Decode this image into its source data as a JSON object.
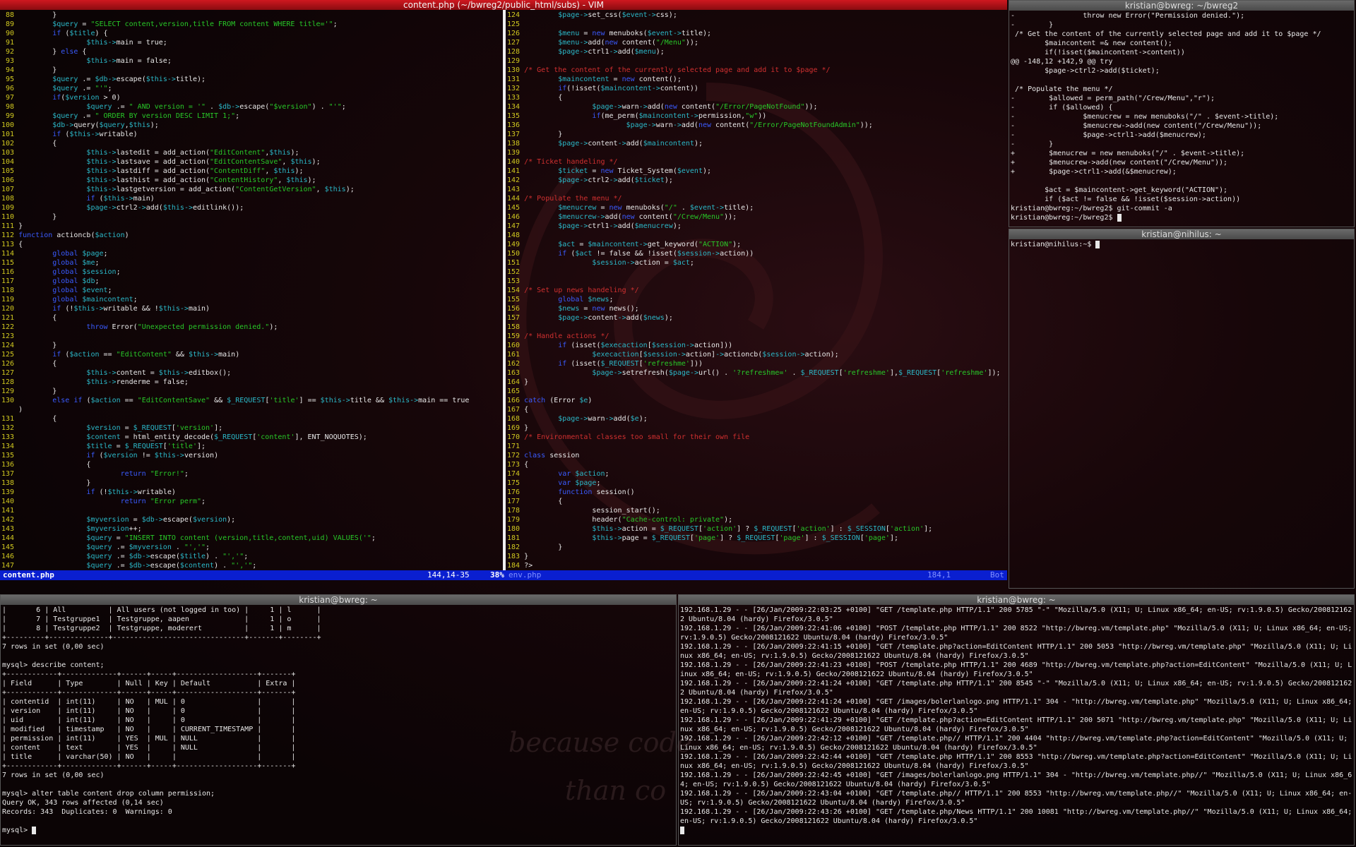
{
  "vim": {
    "title": "content.php (~/bwreg2/public_html/subs) - VIM",
    "status_left_file": "content.php",
    "status_left_pos": "144,14-35",
    "status_left_pct": "38%",
    "status_right_file": "env.php",
    "status_right_pos": "184,1",
    "status_right_pct": "Bot"
  },
  "left_code": [
    {
      "n": "88",
      "t": "        }"
    },
    {
      "n": "89",
      "t": "        $query = \"SELECT content,version,title FROM content WHERE title='\";"
    },
    {
      "n": "90",
      "t": "        if ($title) {"
    },
    {
      "n": "91",
      "t": "                $this->main = true;"
    },
    {
      "n": "92",
      "t": "        } else {"
    },
    {
      "n": "93",
      "t": "                $this->main = false;"
    },
    {
      "n": "94",
      "t": "        }"
    },
    {
      "n": "95",
      "t": "        $query .= $db->escape($this->title);"
    },
    {
      "n": "96",
      "t": "        $query .= \"'\";"
    },
    {
      "n": "97",
      "t": "        if($version > 0)"
    },
    {
      "n": "98",
      "t": "                $query .= \" AND version = '\" . $db->escape(\"$version\") . \"'\";"
    },
    {
      "n": "99",
      "t": "        $query .= \" ORDER BY version DESC LIMIT 1;\";"
    },
    {
      "n": "100",
      "t": "        $db->query($query,$this);"
    },
    {
      "n": "101",
      "t": "        if ($this->writable)"
    },
    {
      "n": "102",
      "t": "        {"
    },
    {
      "n": "103",
      "t": "                $this->lastedit = add_action(\"EditContent\",$this);"
    },
    {
      "n": "104",
      "t": "                $this->lastsave = add_action(\"EditContentSave\", $this);"
    },
    {
      "n": "105",
      "t": "                $this->lastdiff = add_action(\"ContentDiff\", $this);"
    },
    {
      "n": "106",
      "t": "                $this->lasthist = add_action(\"ContentHistory\", $this);"
    },
    {
      "n": "107",
      "t": "                $this->lastgetversion = add_action(\"ContentGetVersion\", $this);"
    },
    {
      "n": "108",
      "t": "                if ($this->main)"
    },
    {
      "n": "109",
      "t": "                $page->ctrl2->add($this->editlink());"
    },
    {
      "n": "110",
      "t": "        }"
    },
    {
      "n": "111",
      "t": "}"
    },
    {
      "n": "112",
      "t": "function actioncb($action)"
    },
    {
      "n": "113",
      "t": "{"
    },
    {
      "n": "114",
      "t": "        global $page;"
    },
    {
      "n": "115",
      "t": "        global $me;"
    },
    {
      "n": "116",
      "t": "        global $session;"
    },
    {
      "n": "117",
      "t": "        global $db;"
    },
    {
      "n": "118",
      "t": "        global $event;"
    },
    {
      "n": "119",
      "t": "        global $maincontent;"
    },
    {
      "n": "120",
      "t": "        if (!$this->writable && !$this->main)"
    },
    {
      "n": "121",
      "t": "        {"
    },
    {
      "n": "122",
      "t": "                throw Error(\"Unexpected permission denied.\");"
    },
    {
      "n": "123",
      "t": ""
    },
    {
      "n": "124",
      "t": "        }"
    },
    {
      "n": "125",
      "t": "        if ($action == \"EditContent\" && $this->main)"
    },
    {
      "n": "126",
      "t": "        {"
    },
    {
      "n": "127",
      "t": "                $this->content = $this->editbox();"
    },
    {
      "n": "128",
      "t": "                $this->renderme = false;"
    },
    {
      "n": "129",
      "t": "        }"
    },
    {
      "n": "130",
      "t": "        else if ($action == \"EditContentSave\" && $_REQUEST['title'] == $this->title && $this->main == true"
    },
    {
      "n": "",
      "t": ")"
    },
    {
      "n": "131",
      "t": "        {"
    },
    {
      "n": "132",
      "t": "                $version = $_REQUEST['version'];"
    },
    {
      "n": "133",
      "t": "                $content = html_entity_decode($_REQUEST['content'], ENT_NOQUOTES);"
    },
    {
      "n": "134",
      "t": "                $title = $_REQUEST['title'];"
    },
    {
      "n": "135",
      "t": "                if ($version != $this->version)"
    },
    {
      "n": "136",
      "t": "                {"
    },
    {
      "n": "137",
      "t": "                        return \"Error!\";"
    },
    {
      "n": "138",
      "t": "                }"
    },
    {
      "n": "139",
      "t": "                if (!$this->writable)"
    },
    {
      "n": "140",
      "t": "                        return \"Error perm\";"
    },
    {
      "n": "141",
      "t": ""
    },
    {
      "n": "142",
      "t": "                $myversion = $db->escape($version);"
    },
    {
      "n": "143",
      "t": "                $myversion++;"
    },
    {
      "n": "144",
      "t": "                $query = \"INSERT INTO content (version,title,content,uid) VALUES('\";"
    },
    {
      "n": "145",
      "t": "                $query .= $myversion . \"','\";"
    },
    {
      "n": "146",
      "t": "                $query .= $db->escape($title) . \"','\";"
    },
    {
      "n": "147",
      "t": "                $query .= $db->escape($content) . \"','\";"
    }
  ],
  "right_code": [
    {
      "n": "124",
      "t": "        $page->set_css($event->css);"
    },
    {
      "n": "125",
      "t": ""
    },
    {
      "n": "126",
      "t": "        $menu = new menuboks($event->title);"
    },
    {
      "n": "127",
      "t": "        $menu->add(new content(\"/Menu\"));"
    },
    {
      "n": "128",
      "t": "        $page->ctrl1->add($menu);"
    },
    {
      "n": "129",
      "t": ""
    },
    {
      "n": "130",
      "t": "/* Get the content of the currently selected page and add it to $page */"
    },
    {
      "n": "131",
      "t": "        $maincontent = new content();"
    },
    {
      "n": "132",
      "t": "        if(!isset($maincontent->content))"
    },
    {
      "n": "133",
      "t": "        {"
    },
    {
      "n": "134",
      "t": "                $page->warn->add(new content(\"/Error/PageNotFound\"));"
    },
    {
      "n": "135",
      "t": "                if(me_perm($maincontent->permission,\"w\"))"
    },
    {
      "n": "136",
      "t": "                        $page->warn->add(new content(\"/Error/PageNotFoundAdmin\"));"
    },
    {
      "n": "137",
      "t": "        }"
    },
    {
      "n": "138",
      "t": "        $page->content->add($maincontent);"
    },
    {
      "n": "139",
      "t": ""
    },
    {
      "n": "140",
      "t": "/* Ticket handeling */"
    },
    {
      "n": "141",
      "t": "        $ticket = new Ticket_System($event);"
    },
    {
      "n": "142",
      "t": "        $page->ctrl2->add($ticket);"
    },
    {
      "n": "143",
      "t": ""
    },
    {
      "n": "144",
      "t": "/* Populate the menu */"
    },
    {
      "n": "145",
      "t": "        $menucrew = new menuboks(\"/\" . $event->title);"
    },
    {
      "n": "146",
      "t": "        $menucrew->add(new content(\"/Crew/Menu\"));"
    },
    {
      "n": "147",
      "t": "        $page->ctrl1->add($menucrew);"
    },
    {
      "n": "148",
      "t": ""
    },
    {
      "n": "149",
      "t": "        $act = $maincontent->get_keyword(\"ACTION\");"
    },
    {
      "n": "150",
      "t": "        if ($act != false && !isset($session->action))"
    },
    {
      "n": "151",
      "t": "                $session->action = $act;"
    },
    {
      "n": "152",
      "t": ""
    },
    {
      "n": "153",
      "t": ""
    },
    {
      "n": "154",
      "t": "/* Set up news handeling */"
    },
    {
      "n": "155",
      "t": "        global $news;"
    },
    {
      "n": "156",
      "t": "        $news = new news();"
    },
    {
      "n": "157",
      "t": "        $page->content->add($news);"
    },
    {
      "n": "158",
      "t": ""
    },
    {
      "n": "159",
      "t": "/* Handle actions */"
    },
    {
      "n": "160",
      "t": "        if (isset($execaction[$session->action]))"
    },
    {
      "n": "161",
      "t": "                $execaction[$session->action]->actioncb($session->action);"
    },
    {
      "n": "162",
      "t": "        if (isset($_REQUEST['refreshme']))"
    },
    {
      "n": "163",
      "t": "                $page->setrefresh($page->url() . '?refreshme=' . $_REQUEST['refreshme'],$_REQUEST['refreshme']);"
    },
    {
      "n": "164",
      "t": "}"
    },
    {
      "n": "165",
      "t": ""
    },
    {
      "n": "166",
      "t": "catch (Error $e)"
    },
    {
      "n": "167",
      "t": "{"
    },
    {
      "n": "168",
      "t": "        $page->warn->add($e);"
    },
    {
      "n": "169",
      "t": "}"
    },
    {
      "n": "170",
      "t": "/* Environmental classes too small for their own file"
    },
    {
      "n": "171",
      "t": ""
    },
    {
      "n": "172",
      "t": "class session"
    },
    {
      "n": "173",
      "t": "{"
    },
    {
      "n": "174",
      "t": "        var $action;"
    },
    {
      "n": "175",
      "t": "        var $page;"
    },
    {
      "n": "176",
      "t": "        function session()"
    },
    {
      "n": "177",
      "t": "        {"
    },
    {
      "n": "178",
      "t": "                session_start();"
    },
    {
      "n": "179",
      "t": "                header(\"Cache-control: private\");"
    },
    {
      "n": "180",
      "t": "                $this->action = $_REQUEST['action'] ? $_REQUEST['action'] : $_SESSION['action'];"
    },
    {
      "n": "181",
      "t": "                $this->page = $_REQUEST['page'] ? $_REQUEST['page'] : $_SESSION['page'];"
    },
    {
      "n": "182",
      "t": "        }"
    },
    {
      "n": "183",
      "t": "}"
    },
    {
      "n": "184",
      "t": "?>"
    }
  ],
  "diff_term": {
    "title": "kristian@bwreg: ~/bwreg2",
    "text": "-                throw new Error(\"Permission denied.\");\n-        }\n /* Get the content of the currently selected page and add it to $page */\n        $maincontent =& new content();\n        if(!isset($maincontent->content))\n@@ -148,12 +142,9 @@ try\n        $page->ctrl2->add($ticket);\n\n /* Populate the menu */\n-        $allowed = perm_path(\"/Crew/Menu\",\"r\");\n-        if ($allowed) {\n-                $menucrew = new menuboks(\"/\" . $event->title);\n-                $menucrew->add(new content(\"/Crew/Menu\"));\n-                $page->ctrl1->add($menucrew);\n-        }\n+        $menucrew = new menuboks(\"/\" . $event->title);\n+        $menucrew->add(new content(\"/Crew/Menu\"));\n+        $page->ctrl1->add(&$menucrew);\n\n        $act = $maincontent->get_keyword(\"ACTION\");\n        if ($act != false && !isset($session->action))\nkristian@bwreg:~/bwreg2$ git-commit -a\nkristian@bwreg:~/bwreg2$ "
  },
  "nihilus_term": {
    "title": "kristian@nihilus: ~",
    "text": "kristian@nihilus:~$ "
  },
  "mysql_term": {
    "title": "kristian@bwreg: ~",
    "text": "|       6 | All          | All users (not logged in too) |     1 | l      |\n|       7 | Testgruppe1  | Testgruppe, aapen             |     1 | o      |\n|       8 | Testgruppe2  | Testgruppe, moderert          |     1 | m      |\n+---------+--------------+-------------------------------+-------+--------+\n7 rows in set (0,00 sec)\n\nmysql> describe content;\n+------------+-------------+------+-----+-------------------+-------+\n| Field      | Type        | Null | Key | Default           | Extra |\n+------------+-------------+------+-----+-------------------+-------+\n| contentid  | int(11)     | NO   | MUL | 0                 |       |\n| version    | int(11)     | NO   |     | 0                 |       |\n| uid        | int(11)     | NO   |     | 0                 |       |\n| modified   | timestamp   | NO   |     | CURRENT_TIMESTAMP |       |\n| permission | int(11)     | YES  | MUL | NULL              |       |\n| content    | text        | YES  |     | NULL              |       |\n| title      | varchar(50) | NO   |     |                   |       |\n+------------+-------------+------+-----+-------------------+-------+\n7 rows in set (0,00 sec)\n\nmysql> alter table content drop column permission;\nQuery OK, 343 rows affected (0,14 sec)\nRecords: 343  Duplicates: 0  Warnings: 0\n\nmysql> "
  },
  "log_term": {
    "title": "kristian@bwreg: ~",
    "text": "192.168.1.29 - - [26/Jan/2009:22:03:25 +0100] \"GET /template.php HTTP/1.1\" 200 5785 \"-\" \"Mozilla/5.0 (X11; U; Linux x86_64; en-US; rv:1.9.0.5) Gecko/2008121622 Ubuntu/8.04 (hardy) Firefox/3.0.5\"\n192.168.1.29 - - [26/Jan/2009:22:41:06 +0100] \"POST /template.php HTTP/1.1\" 200 8522 \"http://bwreg.vm/template.php\" \"Mozilla/5.0 (X11; U; Linux x86_64; en-US; rv:1.9.0.5) Gecko/2008121622 Ubuntu/8.04 (hardy) Firefox/3.0.5\"\n192.168.1.29 - - [26/Jan/2009:22:41:15 +0100] \"GET /template.php?action=EditContent HTTP/1.1\" 200 5053 \"http://bwreg.vm/template.php\" \"Mozilla/5.0 (X11; U; Linux x86_64; en-US; rv:1.9.0.5) Gecko/2008121622 Ubuntu/8.04 (hardy) Firefox/3.0.5\"\n192.168.1.29 - - [26/Jan/2009:22:41:23 +0100] \"POST /template.php HTTP/1.1\" 200 4689 \"http://bwreg.vm/template.php?action=EditContent\" \"Mozilla/5.0 (X11; U; Linux x86_64; en-US; rv:1.9.0.5) Gecko/2008121622 Ubuntu/8.04 (hardy) Firefox/3.0.5\"\n192.168.1.29 - - [26/Jan/2009:22:41:24 +0100] \"GET /template.php HTTP/1.1\" 200 8545 \"-\" \"Mozilla/5.0 (X11; U; Linux x86_64; en-US; rv:1.9.0.5) Gecko/2008121622 Ubuntu/8.04 (hardy) Firefox/3.0.5\"\n192.168.1.29 - - [26/Jan/2009:22:41:24 +0100] \"GET /images/bolerlanlogo.png HTTP/1.1\" 304 - \"http://bwreg.vm/template.php\" \"Mozilla/5.0 (X11; U; Linux x86_64; en-US; rv:1.9.0.5) Gecko/2008121622 Ubuntu/8.04 (hardy) Firefox/3.0.5\"\n192.168.1.29 - - [26/Jan/2009:22:41:29 +0100] \"GET /template.php?action=EditContent HTTP/1.1\" 200 5071 \"http://bwreg.vm/template.php\" \"Mozilla/5.0 (X11; U; Linux x86_64; en-US; rv:1.9.0.5) Gecko/2008121622 Ubuntu/8.04 (hardy) Firefox/3.0.5\"\n192.168.1.29 - - [26/Jan/2009:22:42:12 +0100] \"GET /template.php// HTTP/1.1\" 200 4404 \"http://bwreg.vm/template.php?action=EditContent\" \"Mozilla/5.0 (X11; U; Linux x86_64; en-US; rv:1.9.0.5) Gecko/2008121622 Ubuntu/8.04 (hardy) Firefox/3.0.5\"\n192.168.1.29 - - [26/Jan/2009:22:42:44 +0100] \"GET /template.php HTTP/1.1\" 200 8553 \"http://bwreg.vm/template.php?action=EditContent\" \"Mozilla/5.0 (X11; U; Linux x86_64; en-US; rv:1.9.0.5) Gecko/2008121622 Ubuntu/8.04 (hardy) Firefox/3.0.5\"\n192.168.1.29 - - [26/Jan/2009:22:42:45 +0100] \"GET /images/bolerlanlogo.png HTTP/1.1\" 304 - \"http://bwreg.vm/template.php//\" \"Mozilla/5.0 (X11; U; Linux x86_64; en-US; rv:1.9.0.5) Gecko/2008121622 Ubuntu/8.04 (hardy) Firefox/3.0.5\"\n192.168.1.29 - - [26/Jan/2009:22:43:04 +0100] \"GET /template.php// HTTP/1.1\" 200 8553 \"http://bwreg.vm/template.php//\" \"Mozilla/5.0 (X11; U; Linux x86_64; en-US; rv:1.9.0.5) Gecko/2008121622 Ubuntu/8.04 (hardy) Firefox/3.0.5\"\n192.168.1.29 - - [26/Jan/2009:22:43:26 +0100] \"GET /template.php/News HTTP/1.1\" 200 10081 \"http://bwreg.vm/template.php//\" \"Mozilla/5.0 (X11; U; Linux x86_64; en-US; rv:1.9.0.5) Gecko/2008121622 Ubuntu/8.04 (hardy) Firefox/3.0.5\"\n"
  },
  "wallpaper": {
    "line1": "because code",
    "line2": "than co"
  },
  "colors": {
    "active_title": "#d01820",
    "vim_status": "#0a1fd0",
    "line_number": "#d0c820",
    "keyword": "#3a5bff",
    "string": "#28c828",
    "variable": "#2bb8c8",
    "comment": "#d03030"
  }
}
